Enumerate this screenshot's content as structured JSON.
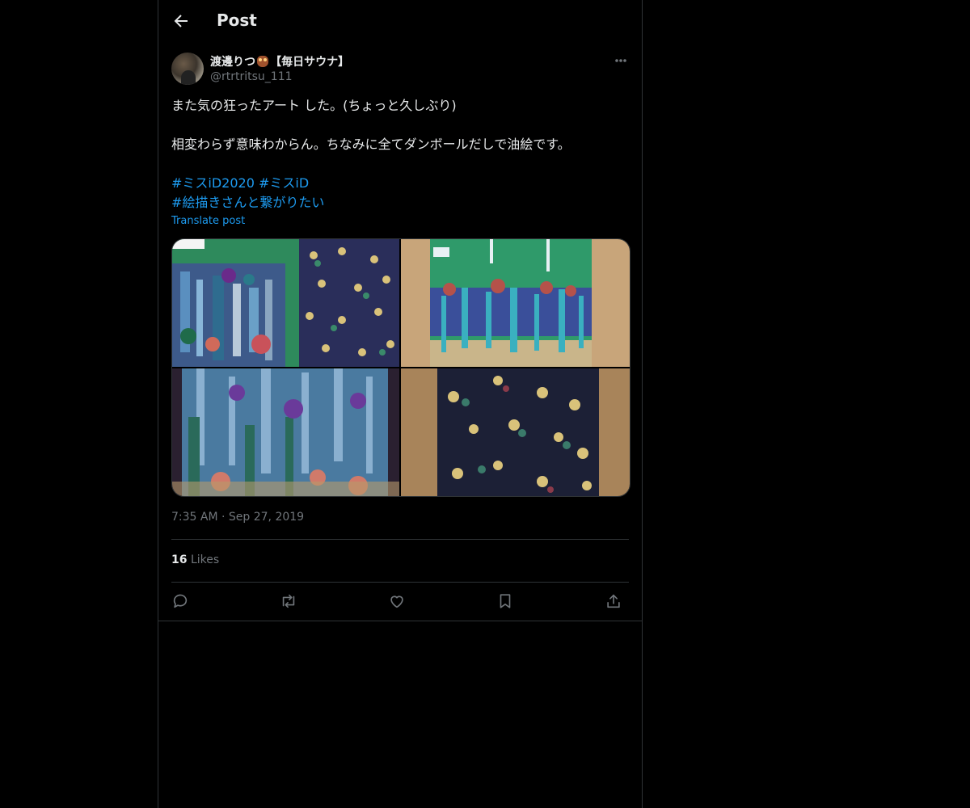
{
  "header": {
    "title": "Post"
  },
  "author": {
    "name_prefix": "渡邊りつ",
    "name_suffix": "【毎日サウナ】",
    "handle": "@rtrtritsu_111"
  },
  "post": {
    "line1": "また気の狂ったアート した。(ちょっと久しぶり)",
    "line2": "相変わらず意味わからん。ちなみに全てダンボールだしで油絵です。",
    "tags_line1": [
      "#ミスiD2020",
      "#ミスiD"
    ],
    "tags_line2": [
      "#絵描きさんと繋がりたい"
    ],
    "translate": "Translate post",
    "timestamp": "7:35 AM · Sep 27, 2019"
  },
  "stats": {
    "likes_count": "16",
    "likes_label": "Likes"
  },
  "icons": {
    "back": "arrow-left-icon",
    "more": "more-horizontal-icon",
    "reply": "reply-icon",
    "repost": "repost-icon",
    "like": "heart-icon",
    "bookmark": "bookmark-icon",
    "share": "share-icon",
    "owl": "owl-emoji-icon"
  },
  "colors": {
    "accent": "#1d9bf0",
    "background": "#000000",
    "secondary_text": "#71767b",
    "border": "#2f3336"
  }
}
